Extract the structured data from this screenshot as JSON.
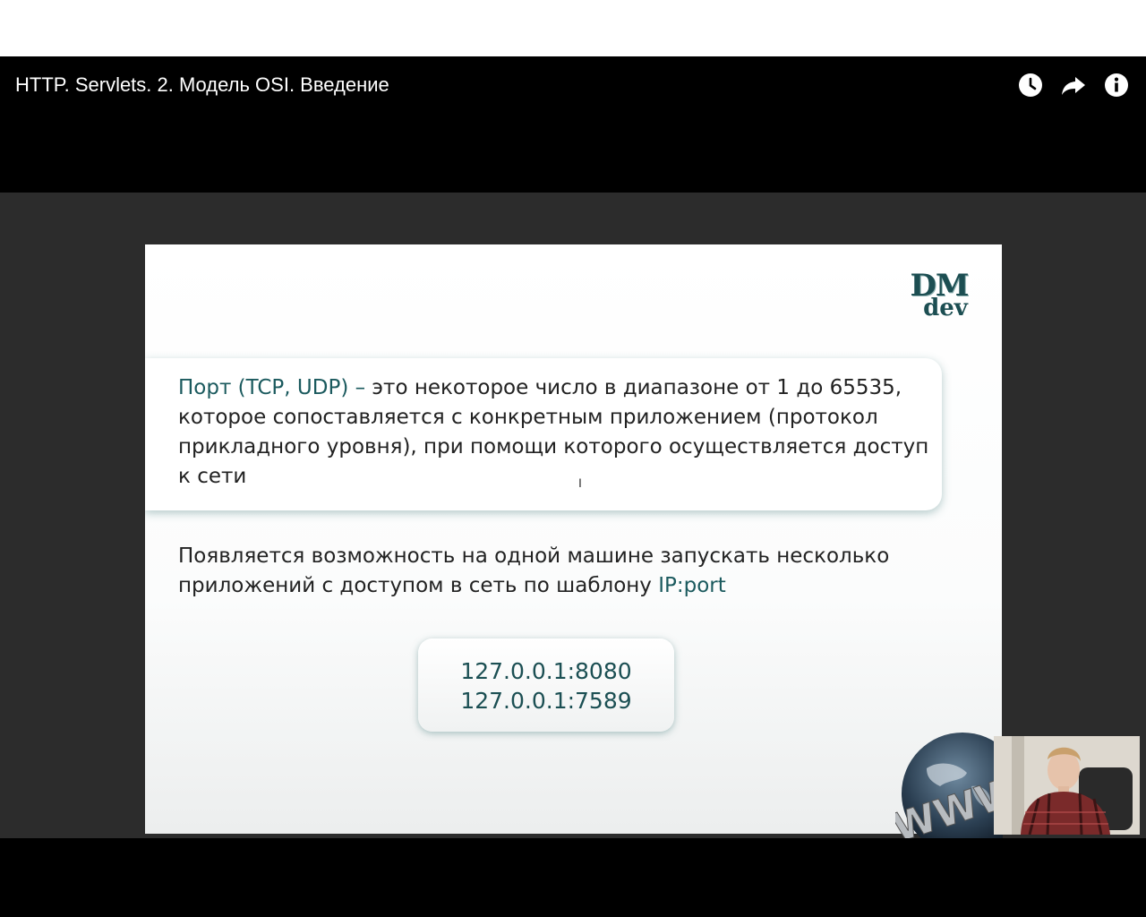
{
  "player": {
    "title": "HTTP. Servlets. 2. Модель OSI. Введение",
    "icons": [
      "watch-later-icon",
      "share-icon",
      "info-icon"
    ]
  },
  "slide": {
    "logo_top": "DM",
    "logo_bottom": "dev",
    "definition_term": "Порт (TCP, UDP) –",
    "definition_text": " это некоторое число в диапазоне от 1 до 65535, которое сопоставляется с конкретным приложением (протокол прикладного уровня), при помощи которого осуществляется доступ к сети",
    "paragraph_text": "Появляется возможность на одной машине запускать несколько приложений с доступом в сеть по шаблону ",
    "paragraph_accent": "IP:port",
    "ip_examples": [
      "127.0.0.1:8080",
      "127.0.0.1:7589"
    ],
    "globe_text": "WWW"
  },
  "colors": {
    "accent": "#1b5a5e",
    "background": "#2c2c2c"
  }
}
